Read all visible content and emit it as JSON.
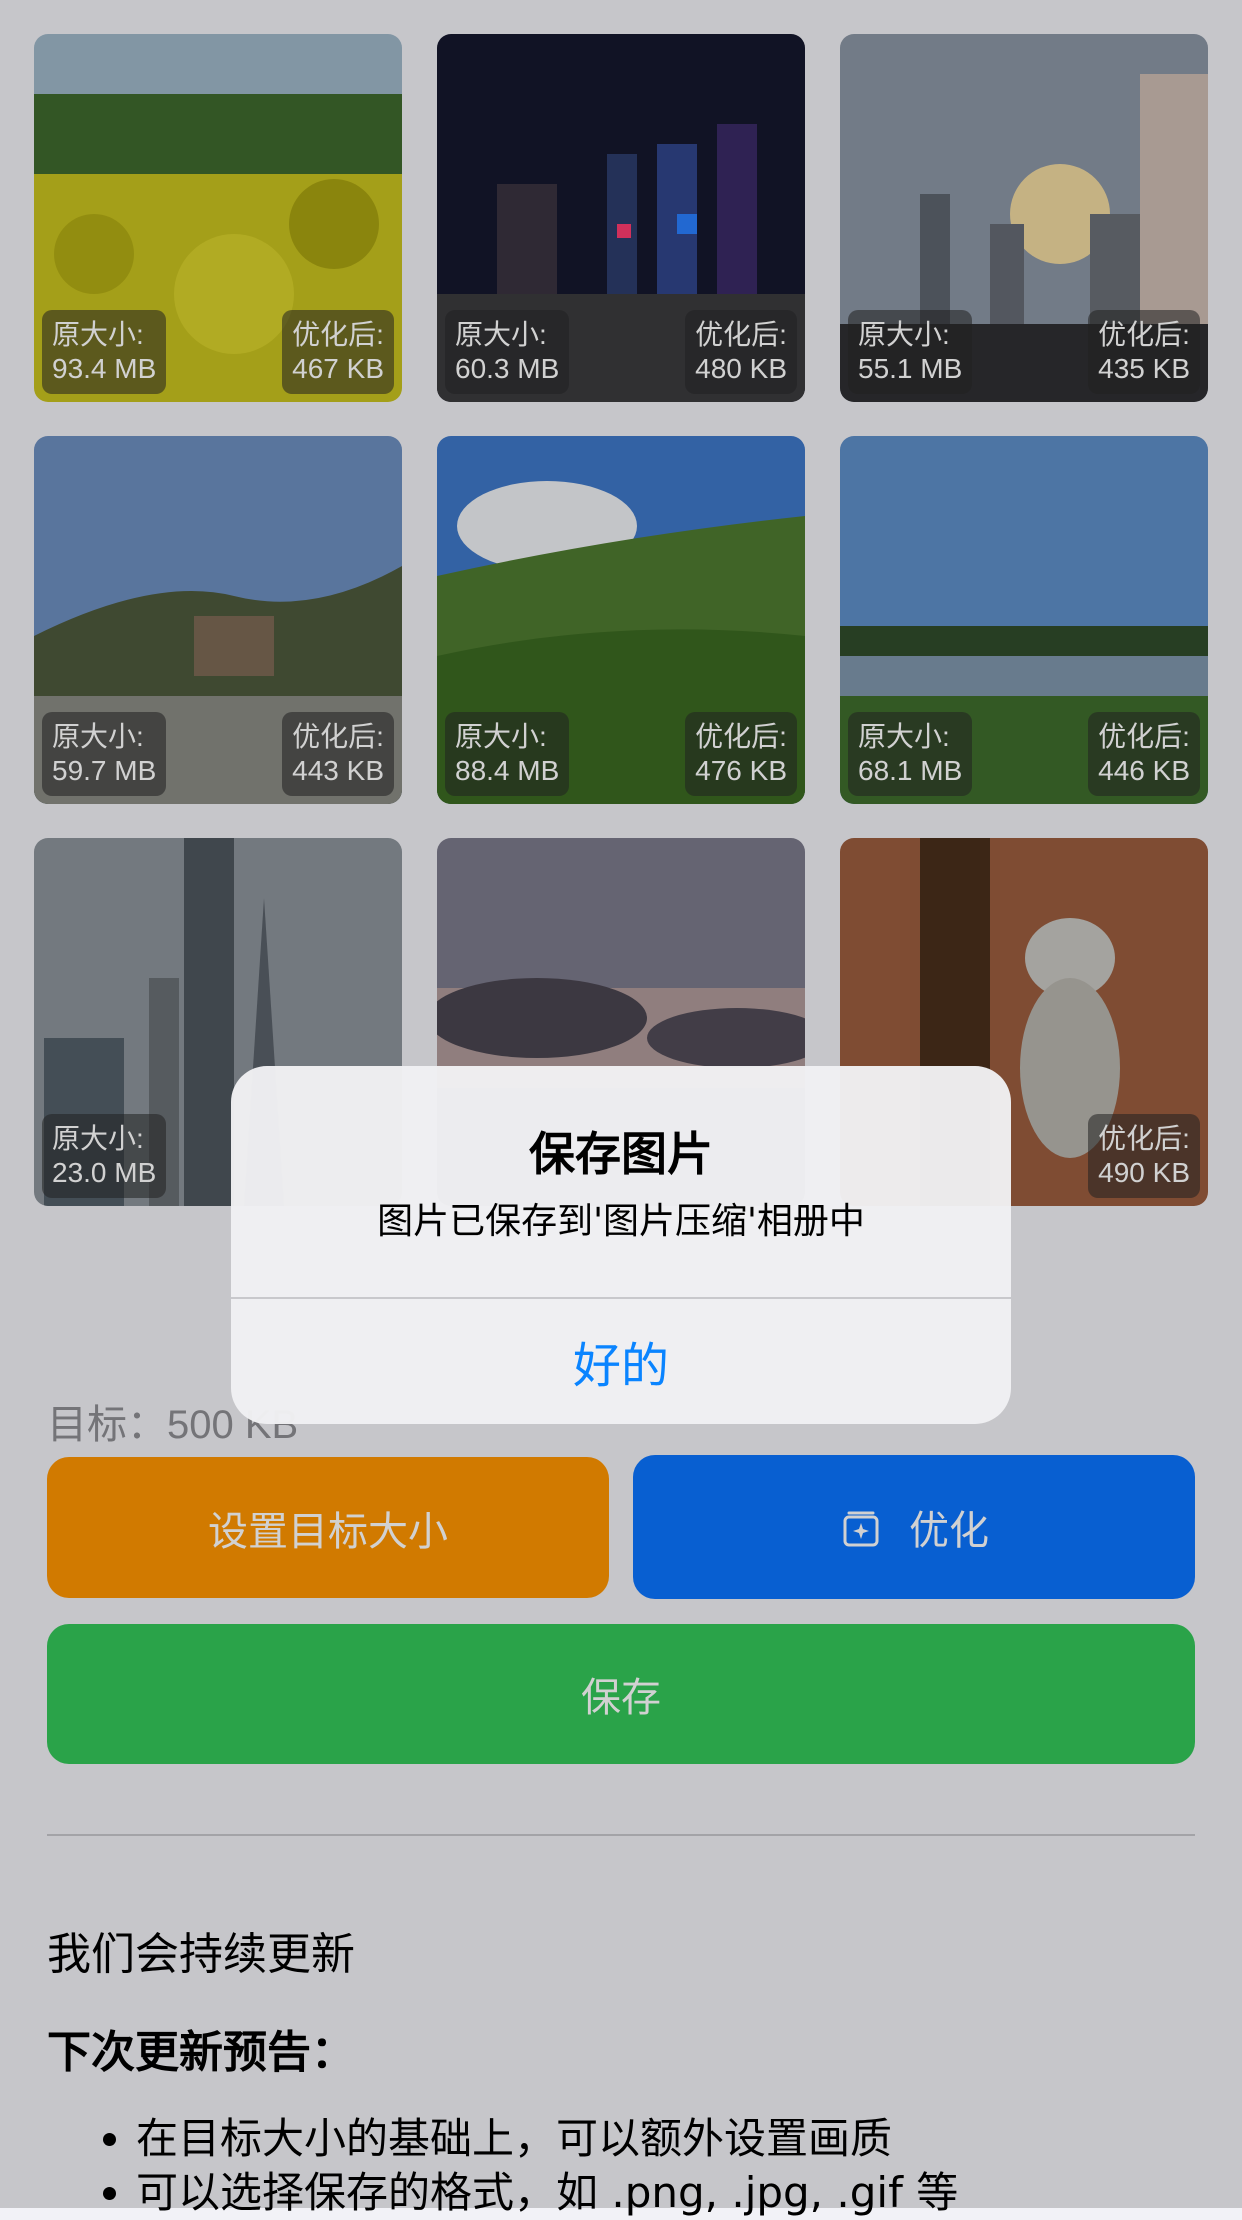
{
  "photos": [
    {
      "orig_label": "原大小:",
      "orig_size": "93.4 MB",
      "opt_label": "优化后:",
      "opt_size": "467 KB",
      "scene": "yellow-flowers"
    },
    {
      "orig_label": "原大小:",
      "orig_size": "60.3 MB",
      "opt_label": "优化后:",
      "opt_size": "480 KB",
      "scene": "night-city"
    },
    {
      "orig_label": "原大小:",
      "orig_size": "55.1 MB",
      "opt_label": "优化后:",
      "opt_size": "435 KB",
      "scene": "sunset-skyline"
    },
    {
      "orig_label": "原大小:",
      "orig_size": "59.7 MB",
      "opt_label": "优化后:",
      "opt_size": "443 KB",
      "scene": "hillside"
    },
    {
      "orig_label": "原大小:",
      "orig_size": "88.4 MB",
      "opt_label": "优化后:",
      "opt_size": "476 KB",
      "scene": "green-valley"
    },
    {
      "orig_label": "原大小:",
      "orig_size": "68.1 MB",
      "opt_label": "优化后:",
      "opt_size": "446 KB",
      "scene": "lake"
    },
    {
      "orig_label": "原大小:",
      "orig_size": "23.0 MB",
      "opt_label": "",
      "opt_size": "",
      "scene": "skyscrapers"
    },
    {
      "orig_label": "",
      "orig_size": "",
      "opt_label": "",
      "opt_size": "",
      "scene": "cloudy-dusk"
    },
    {
      "orig_label": "",
      "orig_size": "",
      "opt_label": "优化后:",
      "opt_size": "490 KB",
      "scene": "cat"
    }
  ],
  "target": {
    "text": "目标：500 KB"
  },
  "buttons": {
    "set_target": "设置目标大小",
    "optimize": "优化",
    "save": "保存"
  },
  "updates": {
    "intro": "我们会持续更新",
    "heading": "下次更新预告：",
    "items": [
      "在目标大小的基础上，可以额外设置画质",
      "可以选择保存的格式，如 .png, .jpg, .gif 等"
    ]
  },
  "alert": {
    "title": "保存图片",
    "message": "图片已保存到'图片压缩'相册中",
    "ok": "好的"
  },
  "colors": {
    "orange": "#ff9500",
    "blue": "#0a74ff",
    "green": "#34c759",
    "link": "#0a84ff"
  }
}
